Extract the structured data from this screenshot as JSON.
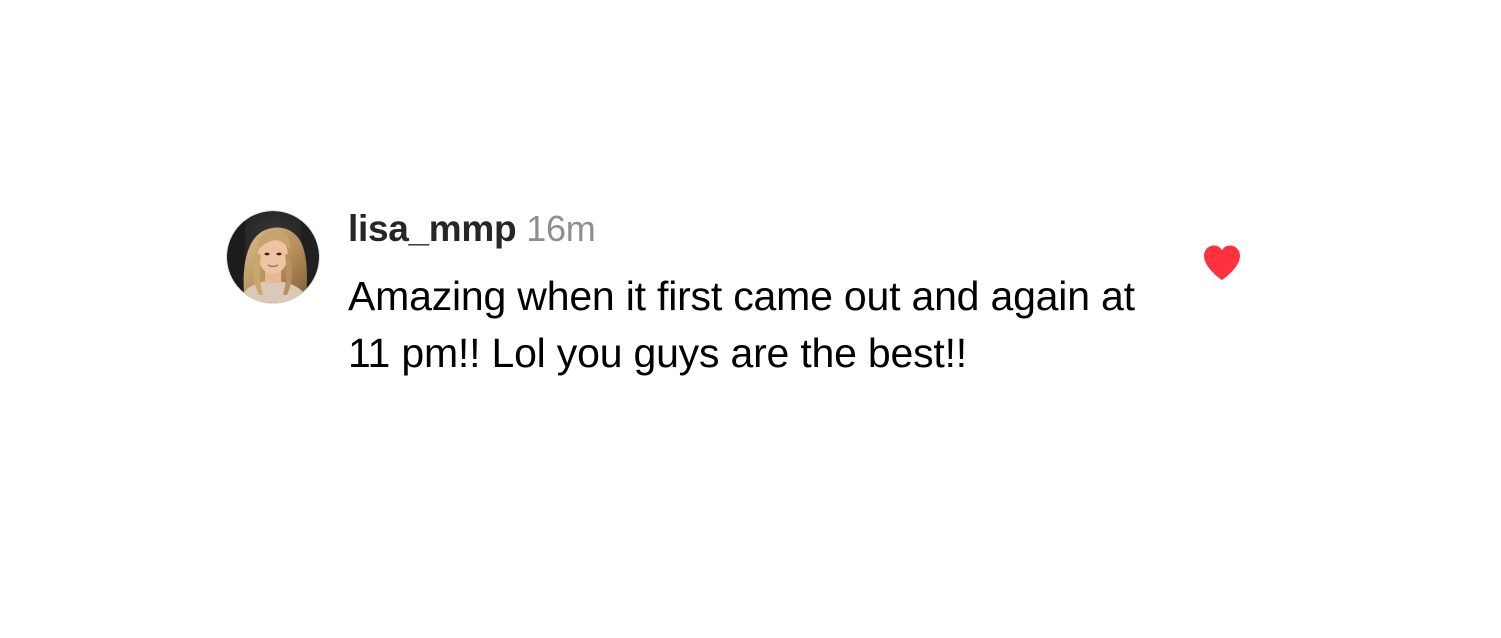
{
  "comment": {
    "username": "lisa_mmp",
    "timestamp": "16m",
    "text": "Amazing when it first came out and again at 11 pm!! Lol you guys are the best!!",
    "liked": true,
    "avatar_icon": "user-photo-avatar",
    "like_icon": "heart-filled-icon"
  },
  "colors": {
    "like_red": "#ff3040",
    "username": "#262626",
    "timestamp": "#8e8e8e",
    "text": "#000000",
    "background": "#ffffff"
  }
}
